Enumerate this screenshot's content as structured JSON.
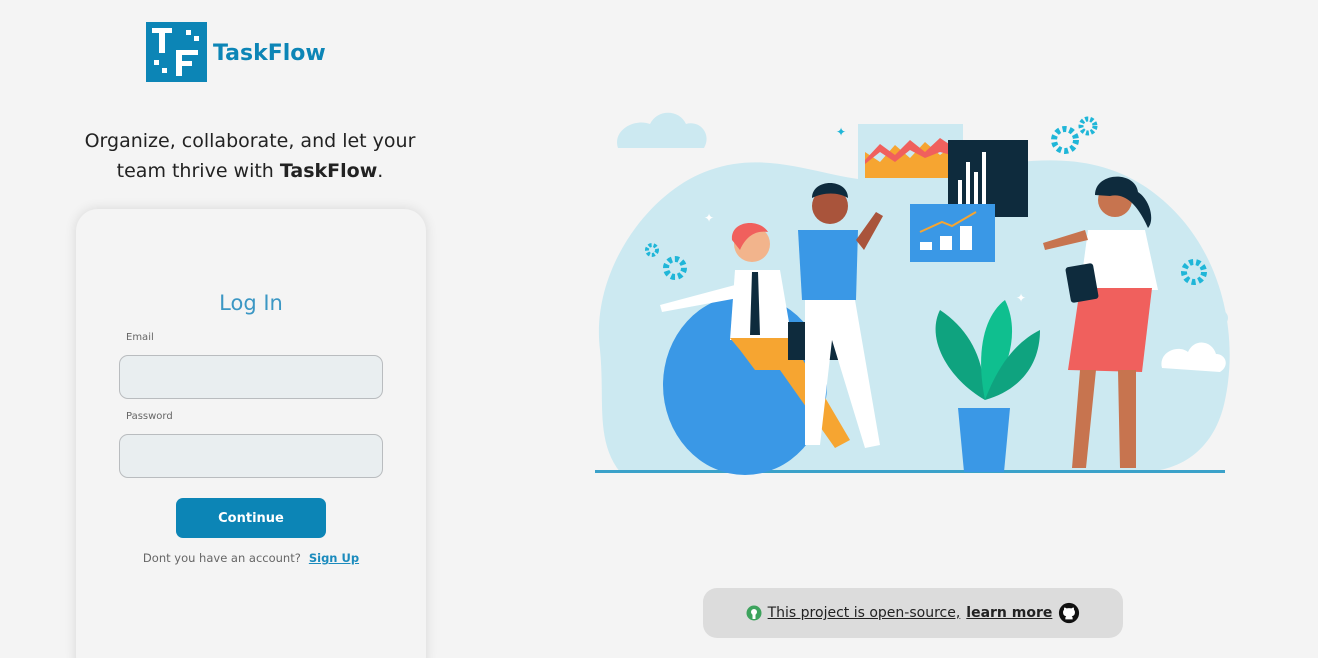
{
  "brand": {
    "logo_letters": "TF",
    "name": "TaskFlow",
    "color": "#0c85b6"
  },
  "tagline": {
    "line1": "Organize, collaborate, and let your",
    "line2_prefix": "team thrive with ",
    "line2_brand": "TaskFlow",
    "line2_suffix": "."
  },
  "login": {
    "title": "Log In",
    "email_label": "Email",
    "email_value": "",
    "password_label": "Password",
    "password_value": "",
    "continue_label": "Continue",
    "no_account_text": "Dont you have an account?",
    "signup_label": "Sign Up"
  },
  "footer": {
    "open_source_icon": "open-source-icon",
    "open_source_text": "This project is open-source,",
    "learn_more": "learn more",
    "github_icon": "github-icon"
  },
  "illustration": {
    "name": "team-collaboration-illustration"
  },
  "colors": {
    "accent": "#0c85b6",
    "title": "#3b97c4",
    "background": "#f4f4f4"
  }
}
